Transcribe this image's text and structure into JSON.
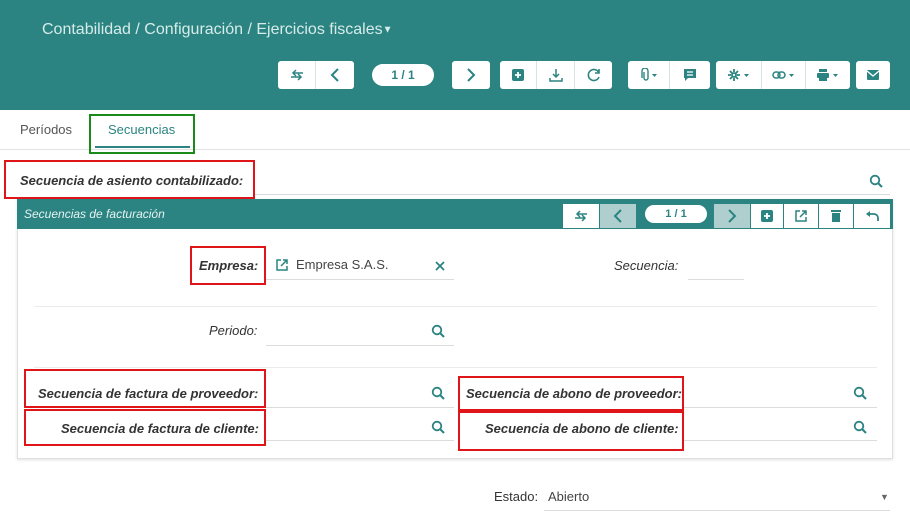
{
  "header": {
    "breadcrumb": "Contabilidad / Configuración / Ejercicios fiscales",
    "record_counter": "1 / 1"
  },
  "tabs": [
    {
      "label": "Períodos",
      "active": false
    },
    {
      "label": "Secuencias",
      "active": true
    }
  ],
  "form": {
    "asiento_label": "Secuencia de asiento contabilizado:",
    "estado_label": "Estado:",
    "estado_value": "Abierto"
  },
  "subform": {
    "title": "Secuencias de facturación",
    "counter": "1 / 1",
    "empresa_label": "Empresa:",
    "empresa_value": "Empresa S.A.S.",
    "secuencia_label": "Secuencia:",
    "periodo_label": "Periodo:",
    "factura_proveedor_label": "Secuencia de factura de proveedor:",
    "abono_proveedor_label": "Secuencia de abono de proveedor:",
    "factura_cliente_label": "Secuencia de factura de cliente:",
    "abono_cliente_label": "Secuencia de abono de cliente:"
  },
  "colors": {
    "primary": "#2b8481",
    "highlight_red": "#e0151a",
    "highlight_green": "#1a8b1a"
  }
}
